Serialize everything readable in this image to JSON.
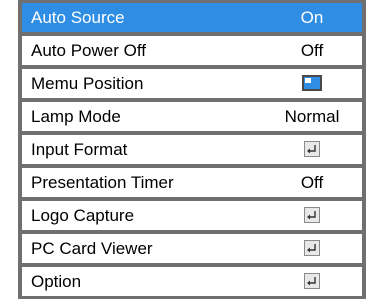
{
  "menu": {
    "items": [
      {
        "label": "Auto Source",
        "value": "On",
        "selected": true
      },
      {
        "label": "Auto Power Off",
        "value": "Off"
      },
      {
        "label": "Memu Position",
        "icon": "menu-position-icon"
      },
      {
        "label": "Lamp Mode",
        "value": "Normal"
      },
      {
        "label": "Input Format",
        "icon": "enter-icon"
      },
      {
        "label": "Presentation Timer",
        "value": "Off"
      },
      {
        "label": "Logo Capture",
        "icon": "enter-icon"
      },
      {
        "label": "PC Card Viewer",
        "icon": "enter-icon"
      },
      {
        "label": "Option",
        "icon": "enter-icon"
      }
    ]
  },
  "colors": {
    "selected_bg": "#2f8de4",
    "row_bg": "#ffffff",
    "border": "#6f6f6f"
  }
}
